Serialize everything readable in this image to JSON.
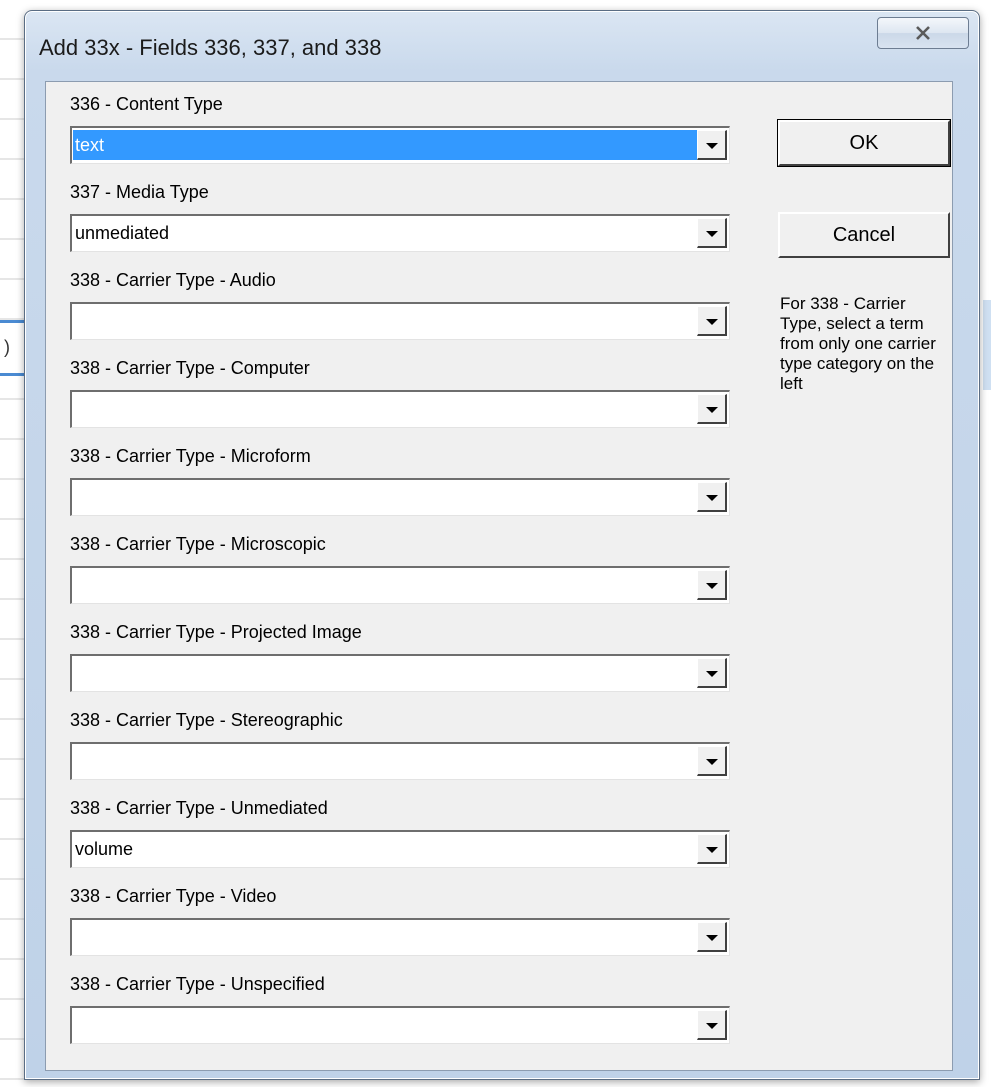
{
  "dialog": {
    "title": "Add 33x - Fields 336, 337, and 338"
  },
  "fields": [
    {
      "label": "336 - Content Type",
      "value": "text",
      "selected": true
    },
    {
      "label": "337 - Media Type",
      "value": "unmediated"
    },
    {
      "label": "338 - Carrier Type - Audio",
      "value": ""
    },
    {
      "label": "338 - Carrier Type - Computer",
      "value": ""
    },
    {
      "label": "338 - Carrier Type - Microform",
      "value": ""
    },
    {
      "label": "338 - Carrier Type - Microscopic",
      "value": ""
    },
    {
      "label": "338 - Carrier Type - Projected Image",
      "value": ""
    },
    {
      "label": "338 - Carrier Type - Stereographic",
      "value": ""
    },
    {
      "label": "338 - Carrier Type - Unmediated",
      "value": "volume"
    },
    {
      "label": "338 - Carrier Type - Video",
      "value": ""
    },
    {
      "label": "338 - Carrier Type - Unspecified",
      "value": ""
    }
  ],
  "buttons": {
    "ok_label": "OK",
    "cancel_label": "Cancel"
  },
  "note": "For 338 - Carrier Type, select a term from only one carrier type category on the left",
  "icons": {
    "close": "close-icon",
    "dropdown": "chevron-down-icon"
  },
  "colors": {
    "selection": "#3399ff",
    "dialog_face": "#f0f0f0",
    "title_glass": "#c9d9ec"
  }
}
